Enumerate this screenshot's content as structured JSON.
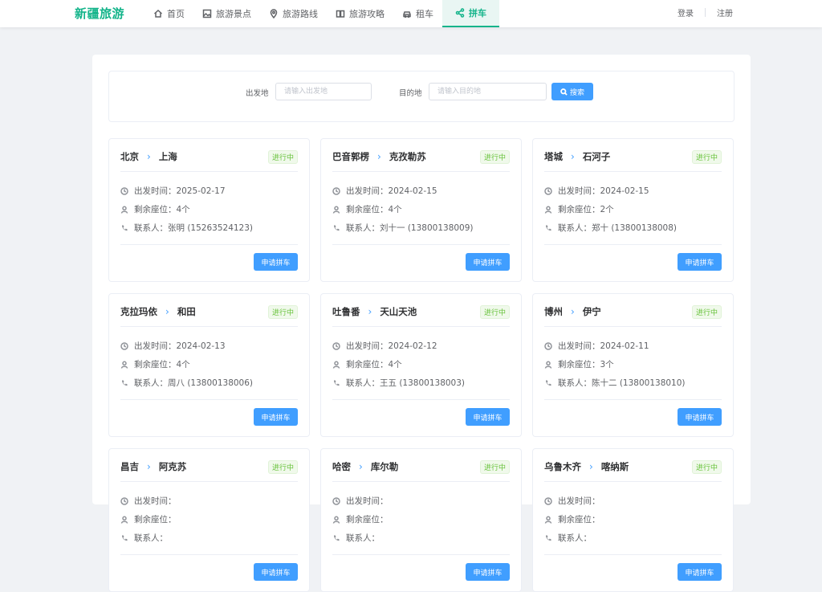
{
  "header": {
    "logo": "新疆旅游",
    "nav": [
      {
        "label": "首页",
        "icon": "home-icon",
        "active": false
      },
      {
        "label": "旅游景点",
        "icon": "picture-icon",
        "active": false
      },
      {
        "label": "旅游路线",
        "icon": "location-pin-icon",
        "active": false
      },
      {
        "label": "旅游攻略",
        "icon": "book-icon",
        "active": false
      },
      {
        "label": "租车",
        "icon": "car-icon",
        "active": false
      },
      {
        "label": "拼车",
        "icon": "share-icon",
        "active": true
      }
    ],
    "login": "登录",
    "register": "注册"
  },
  "search": {
    "from_label": "出发地",
    "from_placeholder": "请输入出发地",
    "to_label": "目的地",
    "to_placeholder": "请输入目的地",
    "button": "搜索"
  },
  "labels": {
    "depart_time": "出发时间：",
    "seats_left": "剩余座位：",
    "contact": "联系人：",
    "apply": "申请拼车"
  },
  "cards": [
    {
      "from": "北京",
      "to": "上海",
      "status": "进行中",
      "date": "2025-02-17",
      "seats": "4个",
      "contact": "张明 (15263524123)"
    },
    {
      "from": "巴音郭楞",
      "to": "克孜勒苏",
      "status": "进行中",
      "date": "2024-02-15",
      "seats": "4个",
      "contact": "刘十一 (13800138009)"
    },
    {
      "from": "塔城",
      "to": "石河子",
      "status": "进行中",
      "date": "2024-02-15",
      "seats": "2个",
      "contact": "郑十 (13800138008)"
    },
    {
      "from": "克拉玛依",
      "to": "和田",
      "status": "进行中",
      "date": "2024-02-13",
      "seats": "4个",
      "contact": "周八 (13800138006)"
    },
    {
      "from": "吐鲁番",
      "to": "天山天池",
      "status": "进行中",
      "date": "2024-02-12",
      "seats": "4个",
      "contact": "王五 (13800138003)"
    },
    {
      "from": "博州",
      "to": "伊宁",
      "status": "进行中",
      "date": "2024-02-11",
      "seats": "3个",
      "contact": "陈十二 (13800138010)"
    },
    {
      "from": "昌吉",
      "to": "阿克苏",
      "status": "进行中",
      "date": "",
      "seats": "",
      "contact": ""
    },
    {
      "from": "哈密",
      "to": "库尔勒",
      "status": "进行中",
      "date": "",
      "seats": "",
      "contact": ""
    },
    {
      "from": "乌鲁木齐",
      "to": "喀纳斯",
      "status": "进行中",
      "date": "",
      "seats": "",
      "contact": ""
    }
  ],
  "colors": {
    "brand": "#13b48a",
    "primary": "#409eff",
    "status_green": "#67c23a"
  }
}
